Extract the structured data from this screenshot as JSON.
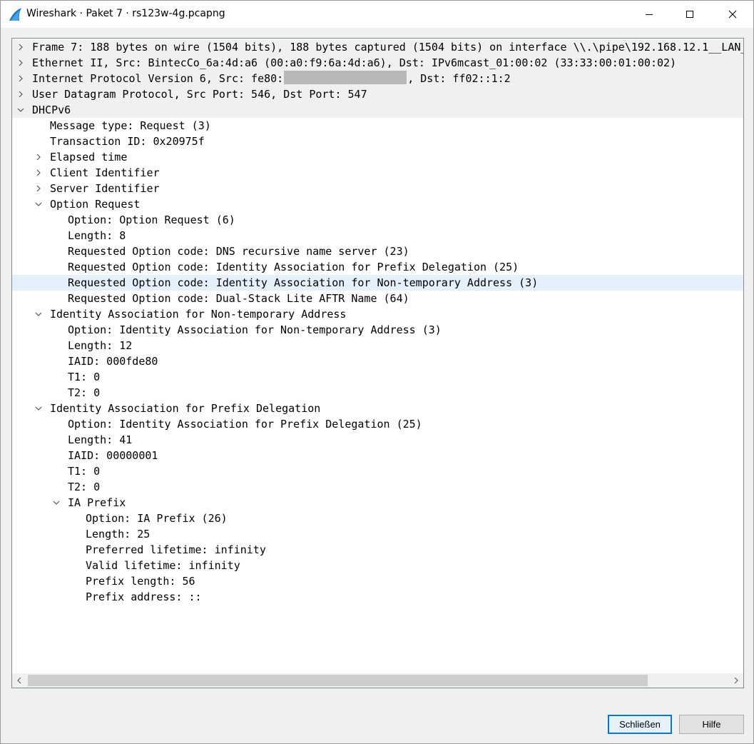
{
  "window": {
    "title": "Wireshark · Paket 7 · rs123w-4g.pcapng"
  },
  "tree": {
    "rows": [
      {
        "depth": 0,
        "expander": "collapsed",
        "top": true,
        "text": "Frame 7: 188 bytes on wire (1504 bits), 188 bytes captured (1504 bits) on interface \\\\.\\pipe\\192.168.12.1__LAN_"
      },
      {
        "depth": 0,
        "expander": "collapsed",
        "top": true,
        "text": "Ethernet II, Src: BintecCo_6a:4d:a6 (00:a0:f9:6a:4d:a6), Dst: IPv6mcast_01:00:02 (33:33:00:01:00:02)"
      },
      {
        "depth": 0,
        "expander": "collapsed",
        "top": true,
        "text_before": "Internet Protocol Version 6, Src: fe80:",
        "redacted": true,
        "text_after": ", Dst: ff02::1:2"
      },
      {
        "depth": 0,
        "expander": "collapsed",
        "top": true,
        "text": "User Datagram Protocol, Src Port: 546, Dst Port: 547"
      },
      {
        "depth": 0,
        "expander": "expanded",
        "top": true,
        "text": "DHCPv6"
      },
      {
        "depth": 1,
        "expander": "none",
        "text": "Message type: Request (3)"
      },
      {
        "depth": 1,
        "expander": "none",
        "text": "Transaction ID: 0x20975f"
      },
      {
        "depth": 1,
        "expander": "collapsed",
        "text": "Elapsed time"
      },
      {
        "depth": 1,
        "expander": "collapsed",
        "text": "Client Identifier"
      },
      {
        "depth": 1,
        "expander": "collapsed",
        "text": "Server Identifier"
      },
      {
        "depth": 1,
        "expander": "expanded",
        "text": "Option Request"
      },
      {
        "depth": 2,
        "expander": "none",
        "text": "Option: Option Request (6)"
      },
      {
        "depth": 2,
        "expander": "none",
        "text": "Length: 8"
      },
      {
        "depth": 2,
        "expander": "none",
        "text": "Requested Option code: DNS recursive name server (23)"
      },
      {
        "depth": 2,
        "expander": "none",
        "text": "Requested Option code: Identity Association for Prefix Delegation (25)"
      },
      {
        "depth": 2,
        "expander": "none",
        "selected": true,
        "text": "Requested Option code: Identity Association for Non-temporary Address (3)"
      },
      {
        "depth": 2,
        "expander": "none",
        "text": "Requested Option code: Dual-Stack Lite AFTR Name (64)"
      },
      {
        "depth": 1,
        "expander": "expanded",
        "text": "Identity Association for Non-temporary Address"
      },
      {
        "depth": 2,
        "expander": "none",
        "text": "Option: Identity Association for Non-temporary Address (3)"
      },
      {
        "depth": 2,
        "expander": "none",
        "text": "Length: 12"
      },
      {
        "depth": 2,
        "expander": "none",
        "text": "IAID: 000fde80"
      },
      {
        "depth": 2,
        "expander": "none",
        "text": "T1: 0"
      },
      {
        "depth": 2,
        "expander": "none",
        "text": "T2: 0"
      },
      {
        "depth": 1,
        "expander": "expanded",
        "text": "Identity Association for Prefix Delegation"
      },
      {
        "depth": 2,
        "expander": "none",
        "text": "Option: Identity Association for Prefix Delegation (25)"
      },
      {
        "depth": 2,
        "expander": "none",
        "text": "Length: 41"
      },
      {
        "depth": 2,
        "expander": "none",
        "text": "IAID: 00000001"
      },
      {
        "depth": 2,
        "expander": "none",
        "text": "T1: 0"
      },
      {
        "depth": 2,
        "expander": "none",
        "text": "T2: 0"
      },
      {
        "depth": 2,
        "expander": "expanded",
        "text": "IA Prefix"
      },
      {
        "depth": 3,
        "expander": "none",
        "text": "Option: IA Prefix (26)"
      },
      {
        "depth": 3,
        "expander": "none",
        "text": "Length: 25"
      },
      {
        "depth": 3,
        "expander": "none",
        "text": "Preferred lifetime: infinity"
      },
      {
        "depth": 3,
        "expander": "none",
        "text": "Valid lifetime: infinity"
      },
      {
        "depth": 3,
        "expander": "none",
        "text": "Prefix length: 56"
      },
      {
        "depth": 3,
        "expander": "none",
        "text": "Prefix address: ::"
      }
    ]
  },
  "buttons": {
    "close_label": "Schließen",
    "help_label": "Hilfe"
  },
  "icons": {
    "app": "wireshark-fin-icon",
    "minimize": "minimize-icon",
    "maximize": "maximize-icon",
    "close": "close-icon",
    "collapsed": "chevron-right-icon",
    "expanded": "chevron-down-icon",
    "scroll_left": "arrow-left-icon",
    "scroll_right": "arrow-right-icon"
  },
  "colors": {
    "accent": "#0078d7",
    "selection": "#e6f0fb",
    "wireshark_blue": "#1679c9"
  }
}
